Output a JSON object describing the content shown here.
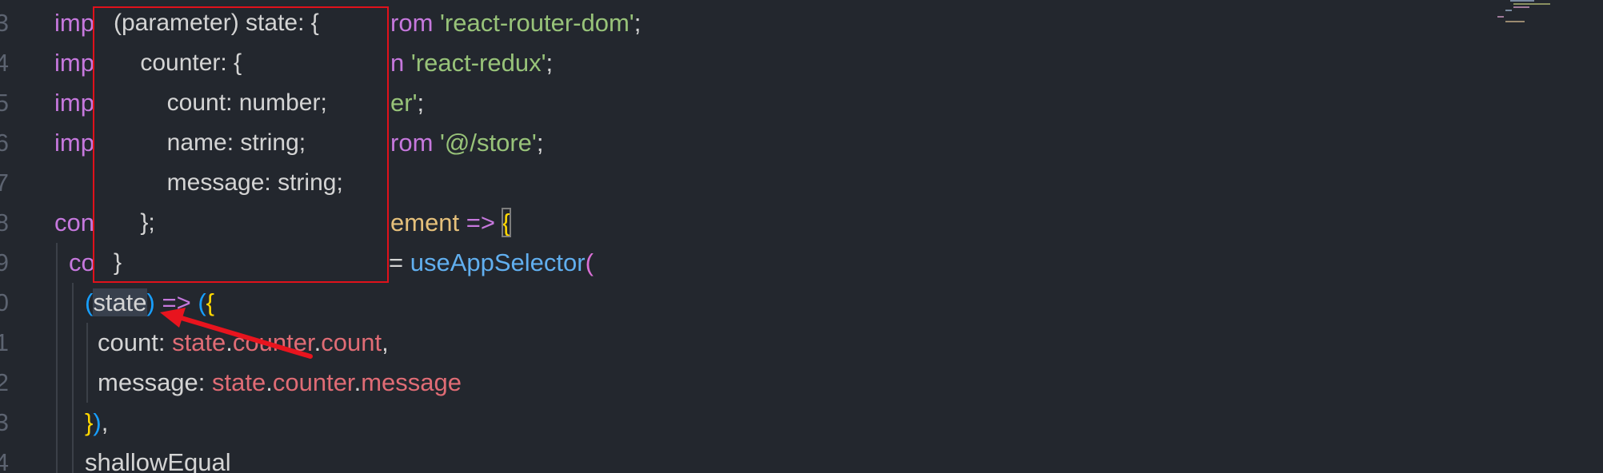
{
  "line_numbers": [
    "3",
    "4",
    "5",
    "6",
    "7",
    "8",
    "9",
    "0",
    "1",
    "2",
    "3",
    "4"
  ],
  "code": {
    "l3_kw": "imp",
    "l3_from": "rom ",
    "l3_str": "'react-router-dom'",
    "l3_semi": ";",
    "l4_kw": "imp",
    "l4_from": "n ",
    "l4_str": "'react-redux'",
    "l4_semi": ";",
    "l5_kw": "imp",
    "l5_str": "er'",
    "l5_semi": ";",
    "l6_kw": "imp",
    "l6_from": "rom ",
    "l6_str": "'@/store'",
    "l6_semi": ";",
    "l8_kw": "con",
    "l8_type": "ement",
    "l8_arrow": " => ",
    "l8_brace": "{",
    "l9_kw": "co",
    "l9_eq": "= ",
    "l9_fn": "useAppSelector",
    "l9_paren": "(",
    "l10_open": "(",
    "l10_param": "state",
    "l10_close": ")",
    "l10_arrow": " => ",
    "l10_paren": "(",
    "l10_brace": "{",
    "l11_key": "count: ",
    "l11_obj": "state",
    "l11_dot1": ".",
    "l11_prop1": "counter",
    "l11_dot2": ".",
    "l11_prop2": "count",
    "l11_comma": ",",
    "l12_key": "message: ",
    "l12_obj": "state",
    "l12_dot1": ".",
    "l12_prop1": "counter",
    "l12_dot2": ".",
    "l12_prop2": "message",
    "l13_brace": "}",
    "l13_paren": ")",
    "l13_comma": ",",
    "l14_text": "shallowEqual"
  },
  "tooltip": {
    "lines": [
      "(parameter) state: {",
      "    counter: {",
      "        count: number;",
      "        name: string;",
      "        message: string;",
      "    };",
      "}"
    ]
  },
  "colors": {
    "background": "#23272e",
    "keyword": "#c678dd",
    "string": "#98c379",
    "function": "#61afef",
    "variable": "#e06c75",
    "type": "#e5c07b",
    "tooltip_border": "#e0111b",
    "annotation_arrow": "#e8141e"
  },
  "annotation": {
    "arrow_icon": "red-arrow-icon"
  }
}
